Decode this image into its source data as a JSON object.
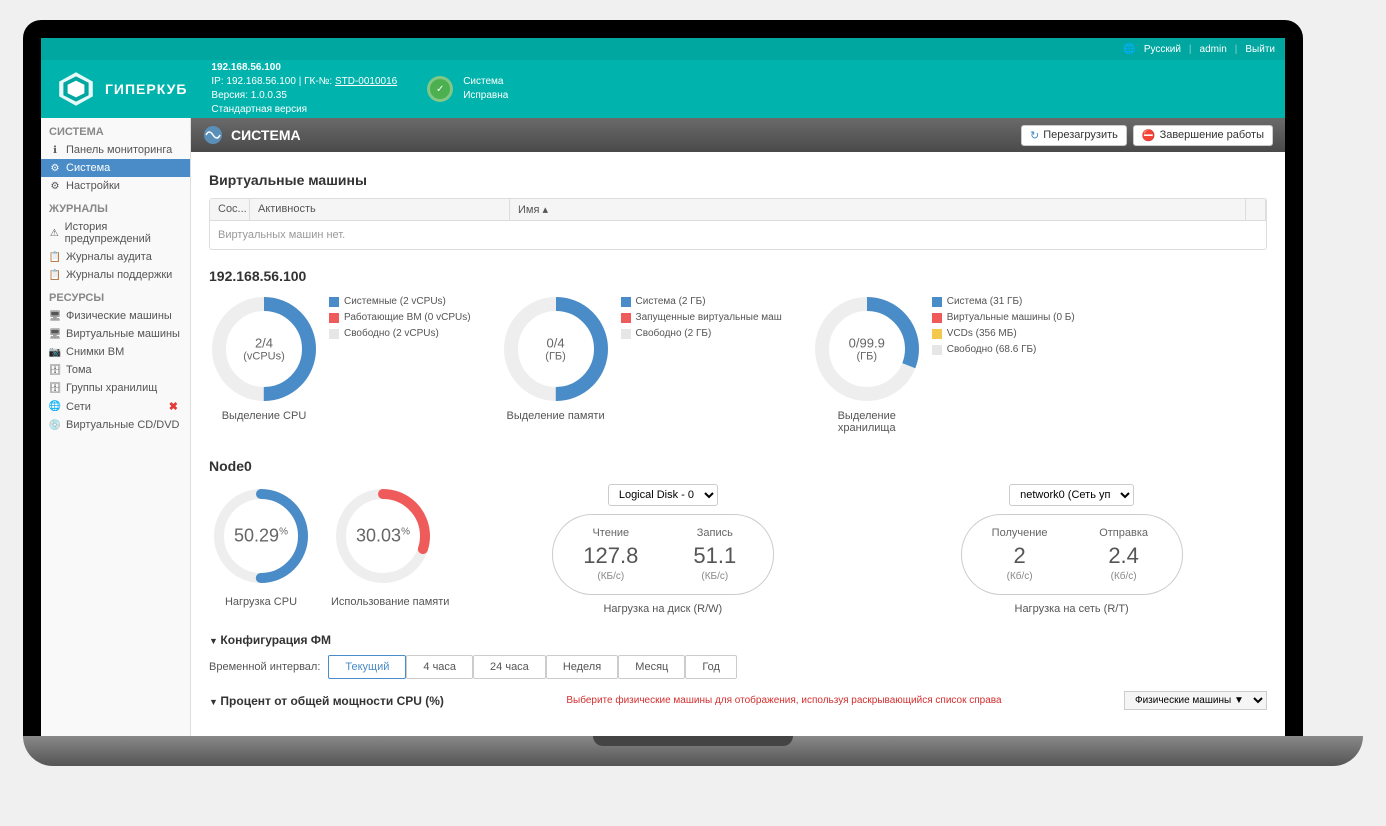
{
  "topbar": {
    "lang": "Русский",
    "user": "admin",
    "logout": "Выйти"
  },
  "brand": {
    "name": "ГИПЕРКУБ"
  },
  "header_info": {
    "ip_label": "192.168.56.100",
    "line2_prefix": "IP: 192.168.56.100  |  ГК-№: ",
    "line2_link": "STD-0010016",
    "line3": "Версия: 1.0.0.35",
    "line4": "Стандартная версия"
  },
  "status": {
    "l1": "Система",
    "l2": "Исправна"
  },
  "sidebar": {
    "s1": "СИСТЕМА",
    "items1": [
      {
        "icon": "ℹ",
        "label": "Панель мониторинга"
      },
      {
        "icon": "⚙",
        "label": "Система",
        "active": true
      },
      {
        "icon": "⚙",
        "label": "Настройки"
      }
    ],
    "s2": "ЖУРНАЛЫ",
    "items2": [
      {
        "icon": "⚠",
        "label": "История предупреждений"
      },
      {
        "icon": "📋",
        "label": "Журналы аудита"
      },
      {
        "icon": "📋",
        "label": "Журналы поддержки"
      }
    ],
    "s3": "РЕСУРСЫ",
    "items3": [
      {
        "icon": "🖥",
        "label": "Физические машины"
      },
      {
        "icon": "🖥",
        "label": "Виртуальные машины"
      },
      {
        "icon": "📷",
        "label": "Снимки ВМ"
      },
      {
        "icon": "🗄",
        "label": "Тома"
      },
      {
        "icon": "🗄",
        "label": "Группы хранилищ"
      },
      {
        "icon": "🌐",
        "label": "Сети",
        "err": true
      },
      {
        "icon": "💿",
        "label": "Виртуальные CD/DVD"
      }
    ]
  },
  "main_header": {
    "title": "СИСТЕМА",
    "reload": "Перезагрузить",
    "shutdown": "Завершение работы"
  },
  "vm_section": {
    "title": "Виртуальные машины",
    "cols": {
      "c1": "Сос...",
      "c2": "Активность",
      "c3": "Имя ▴"
    },
    "empty": "Виртуальных машин нет."
  },
  "ip_section_title": "192.168.56.100",
  "donuts": [
    {
      "center": "2/4",
      "unit": "(vCPUs)",
      "label": "Выделение CPU",
      "legend": [
        {
          "c": "#4a8cc7",
          "t": "Системные (2 vCPUs)"
        },
        {
          "c": "#ef5b5b",
          "t": "Работающие ВМ (0 vCPUs)"
        },
        {
          "c": "#e6e6e6",
          "t": "Свободно (2 vCPUs)"
        }
      ],
      "pct": 50
    },
    {
      "center": "0/4",
      "unit": "(ГБ)",
      "label": "Выделение памяти",
      "legend": [
        {
          "c": "#4a8cc7",
          "t": "Система (2 ГБ)"
        },
        {
          "c": "#ef5b5b",
          "t": "Запущенные виртуальные маш"
        },
        {
          "c": "#e6e6e6",
          "t": "Свободно (2 ГБ)"
        }
      ],
      "pct": 50
    },
    {
      "center": "0/99.9",
      "unit": "(ГБ)",
      "label": "Выделение хранилища",
      "legend": [
        {
          "c": "#4a8cc7",
          "t": "Система (31 ГБ)"
        },
        {
          "c": "#ef5b5b",
          "t": "Виртуальные машины (0 Б)"
        },
        {
          "c": "#f2c94c",
          "t": "VCDs (356 МБ)"
        },
        {
          "c": "#e6e6e6",
          "t": "Свободно (68.6 ГБ)"
        }
      ],
      "pct": 31
    }
  ],
  "node": {
    "title": "Node0",
    "disk_select": "Logical Disk - 0",
    "net_select": "network0 (Сеть уп",
    "cpu": {
      "val": "50.29",
      "label": "Нагрузка CPU",
      "color": "#4a8cc7",
      "pct": 50
    },
    "mem": {
      "val": "30.03",
      "label": "Использование памяти",
      "color": "#ef5b5b",
      "pct": 30
    },
    "disk": {
      "label": "Нагрузка на диск (R/W)",
      "read": {
        "t": "Чтение",
        "v": "127.8",
        "u": "(КБ/с)"
      },
      "write": {
        "t": "Запись",
        "v": "51.1",
        "u": "(КБ/с)"
      }
    },
    "net": {
      "label": "Нагрузка на сеть (R/T)",
      "rx": {
        "t": "Получение",
        "v": "2",
        "u": "(Кб/с)"
      },
      "tx": {
        "t": "Отправка",
        "v": "2.4",
        "u": "(Кб/с)"
      }
    }
  },
  "config": {
    "title": "Конфигурация ФМ",
    "interval_label": "Временной интервал:",
    "intervals": [
      "Текущий",
      "4 часа",
      "24 часа",
      "Неделя",
      "Месяц",
      "Год"
    ],
    "cpu_title": "Процент от общей мощности CPU (%)",
    "cpu_warn": "Выберите физические машины для отображения, используя раскрывающийся список справа",
    "pm_select": "Физические машины ▼"
  },
  "chart_data": [
    {
      "type": "pie",
      "title": "Выделение CPU",
      "series": [
        {
          "name": "Системные",
          "value": 2
        },
        {
          "name": "Работающие ВМ",
          "value": 0
        },
        {
          "name": "Свободно",
          "value": 2
        }
      ],
      "unit": "vCPUs"
    },
    {
      "type": "pie",
      "title": "Выделение памяти",
      "series": [
        {
          "name": "Система",
          "value": 2
        },
        {
          "name": "Запущенные ВМ",
          "value": 0
        },
        {
          "name": "Свободно",
          "value": 2
        }
      ],
      "unit": "ГБ"
    },
    {
      "type": "pie",
      "title": "Выделение хранилища",
      "series": [
        {
          "name": "Система",
          "value": 31
        },
        {
          "name": "Виртуальные машины",
          "value": 0
        },
        {
          "name": "VCDs",
          "value": 0.356
        },
        {
          "name": "Свободно",
          "value": 68.6
        }
      ],
      "unit": "ГБ"
    }
  ]
}
